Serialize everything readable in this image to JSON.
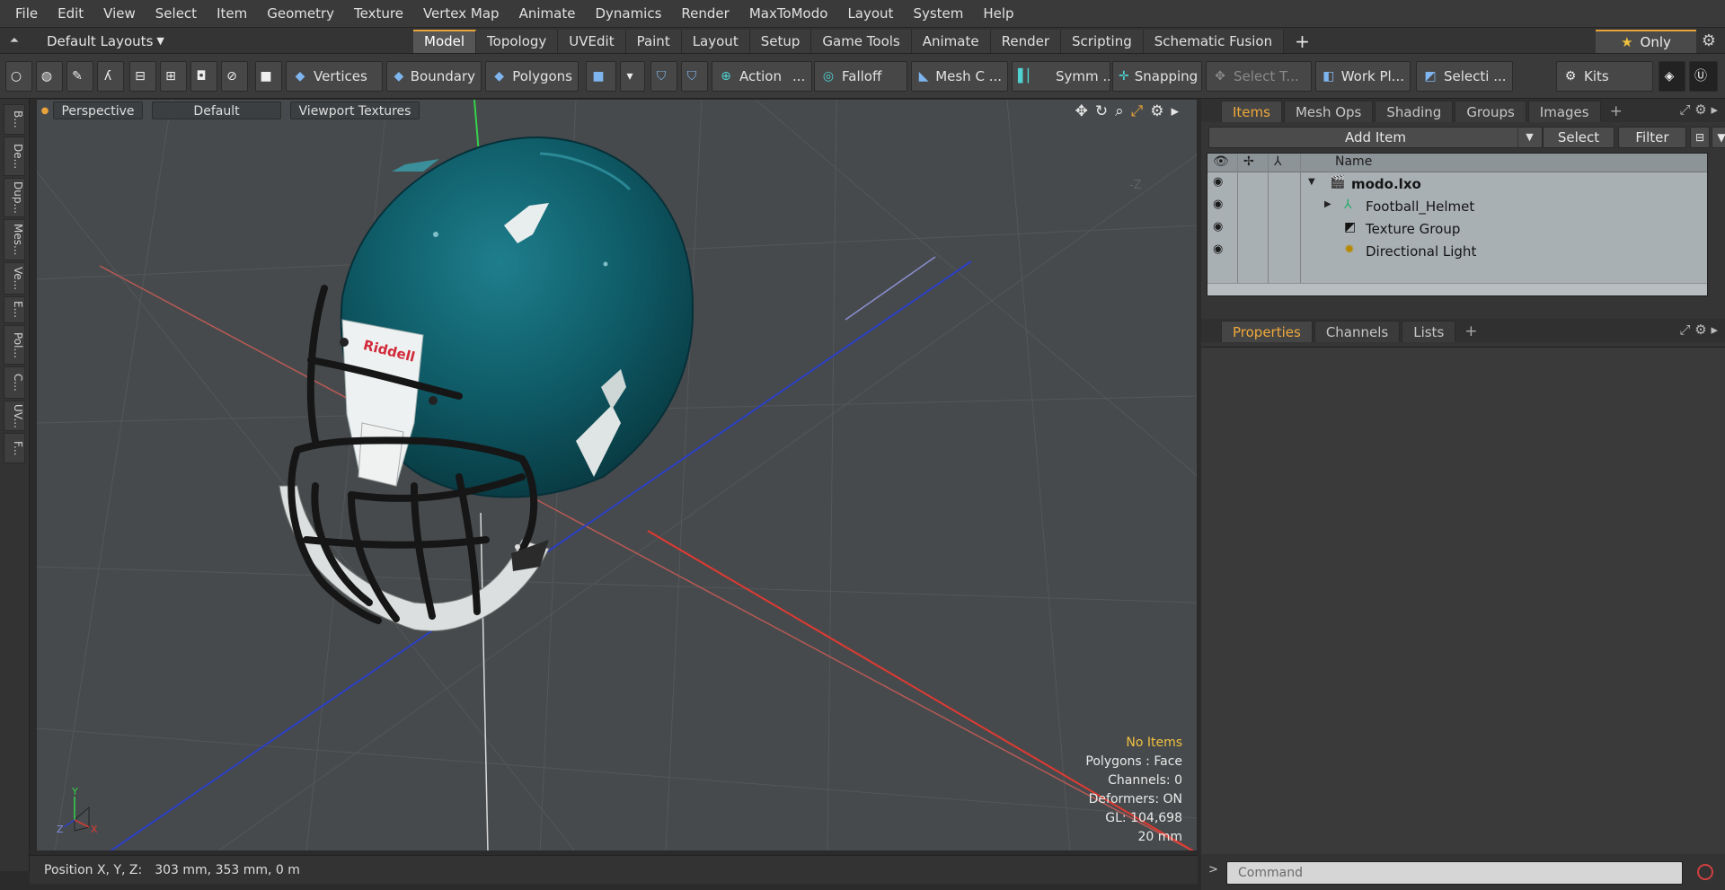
{
  "menu": [
    "File",
    "Edit",
    "View",
    "Select",
    "Item",
    "Geometry",
    "Texture",
    "Vertex Map",
    "Animate",
    "Dynamics",
    "Render",
    "MaxToModo",
    "Layout",
    "System",
    "Help"
  ],
  "layout_bar": {
    "layout_name": "Default Layouts",
    "tabs": [
      "Model",
      "Topology",
      "UVEdit",
      "Paint",
      "Layout",
      "Setup",
      "Game Tools",
      "Animate",
      "Render",
      "Scripting",
      "Schematic Fusion"
    ],
    "active_tab": "Model",
    "only_label": "Only"
  },
  "toolbar": {
    "vertices": "Vertices",
    "boundary": "Boundary",
    "polygons": "Polygons",
    "action": "Action",
    "action_more": "...",
    "falloff": "Falloff",
    "mesh_c": "Mesh C ...",
    "symm": "Symm ...",
    "snapping": "Snapping",
    "select_t": "Select T...",
    "work_pl": "Work Pl...",
    "selecti": "Selecti ...",
    "kits": "Kits"
  },
  "left_tabs": [
    "B...",
    "De...",
    "Dup...",
    "Mes...",
    "Ve...",
    "E...",
    "Pol...",
    "C...",
    "UV...",
    "F..."
  ],
  "viewport": {
    "view_mode": "Perspective",
    "shading": "Default",
    "textures": "Viewport Textures",
    "axis_label_z": "-Z",
    "info": {
      "selection": "No Items",
      "polygons": "Polygons : Face",
      "channels": "Channels: 0",
      "deformers": "Deformers: ON",
      "gl": "GL: 104,698",
      "grid": "20 mm"
    },
    "gizmo": {
      "y": "Y",
      "z": "Z",
      "x": "X"
    },
    "helmet_brand": "Riddell"
  },
  "status_bar": {
    "position_label": "Position X, Y, Z:",
    "position_value": "303 mm, 353 mm, 0 m"
  },
  "items_panel": {
    "tabs": [
      "Items",
      "Mesh Ops",
      "Shading",
      "Groups",
      "Images"
    ],
    "active_tab": "Items",
    "add_item": "Add Item",
    "select": "Select",
    "filter": "Filter",
    "column_name": "Name",
    "rows": [
      {
        "label": "modo.lxo",
        "icon": "scene-icon"
      },
      {
        "label": "Football_Helmet",
        "icon": "mesh-locator-icon"
      },
      {
        "label": "Texture Group",
        "icon": "folder-icon"
      },
      {
        "label": "Directional Light",
        "icon": "light-icon"
      }
    ]
  },
  "properties_panel": {
    "tabs": [
      "Properties",
      "Channels",
      "Lists"
    ],
    "active_tab": "Properties"
  },
  "command": {
    "placeholder": "Command"
  },
  "colors": {
    "accent": "#e8a33a",
    "helmet_shell": "#0d5560",
    "viewport_bg": "#474a4c",
    "items_bg": "#a9b0b4"
  }
}
